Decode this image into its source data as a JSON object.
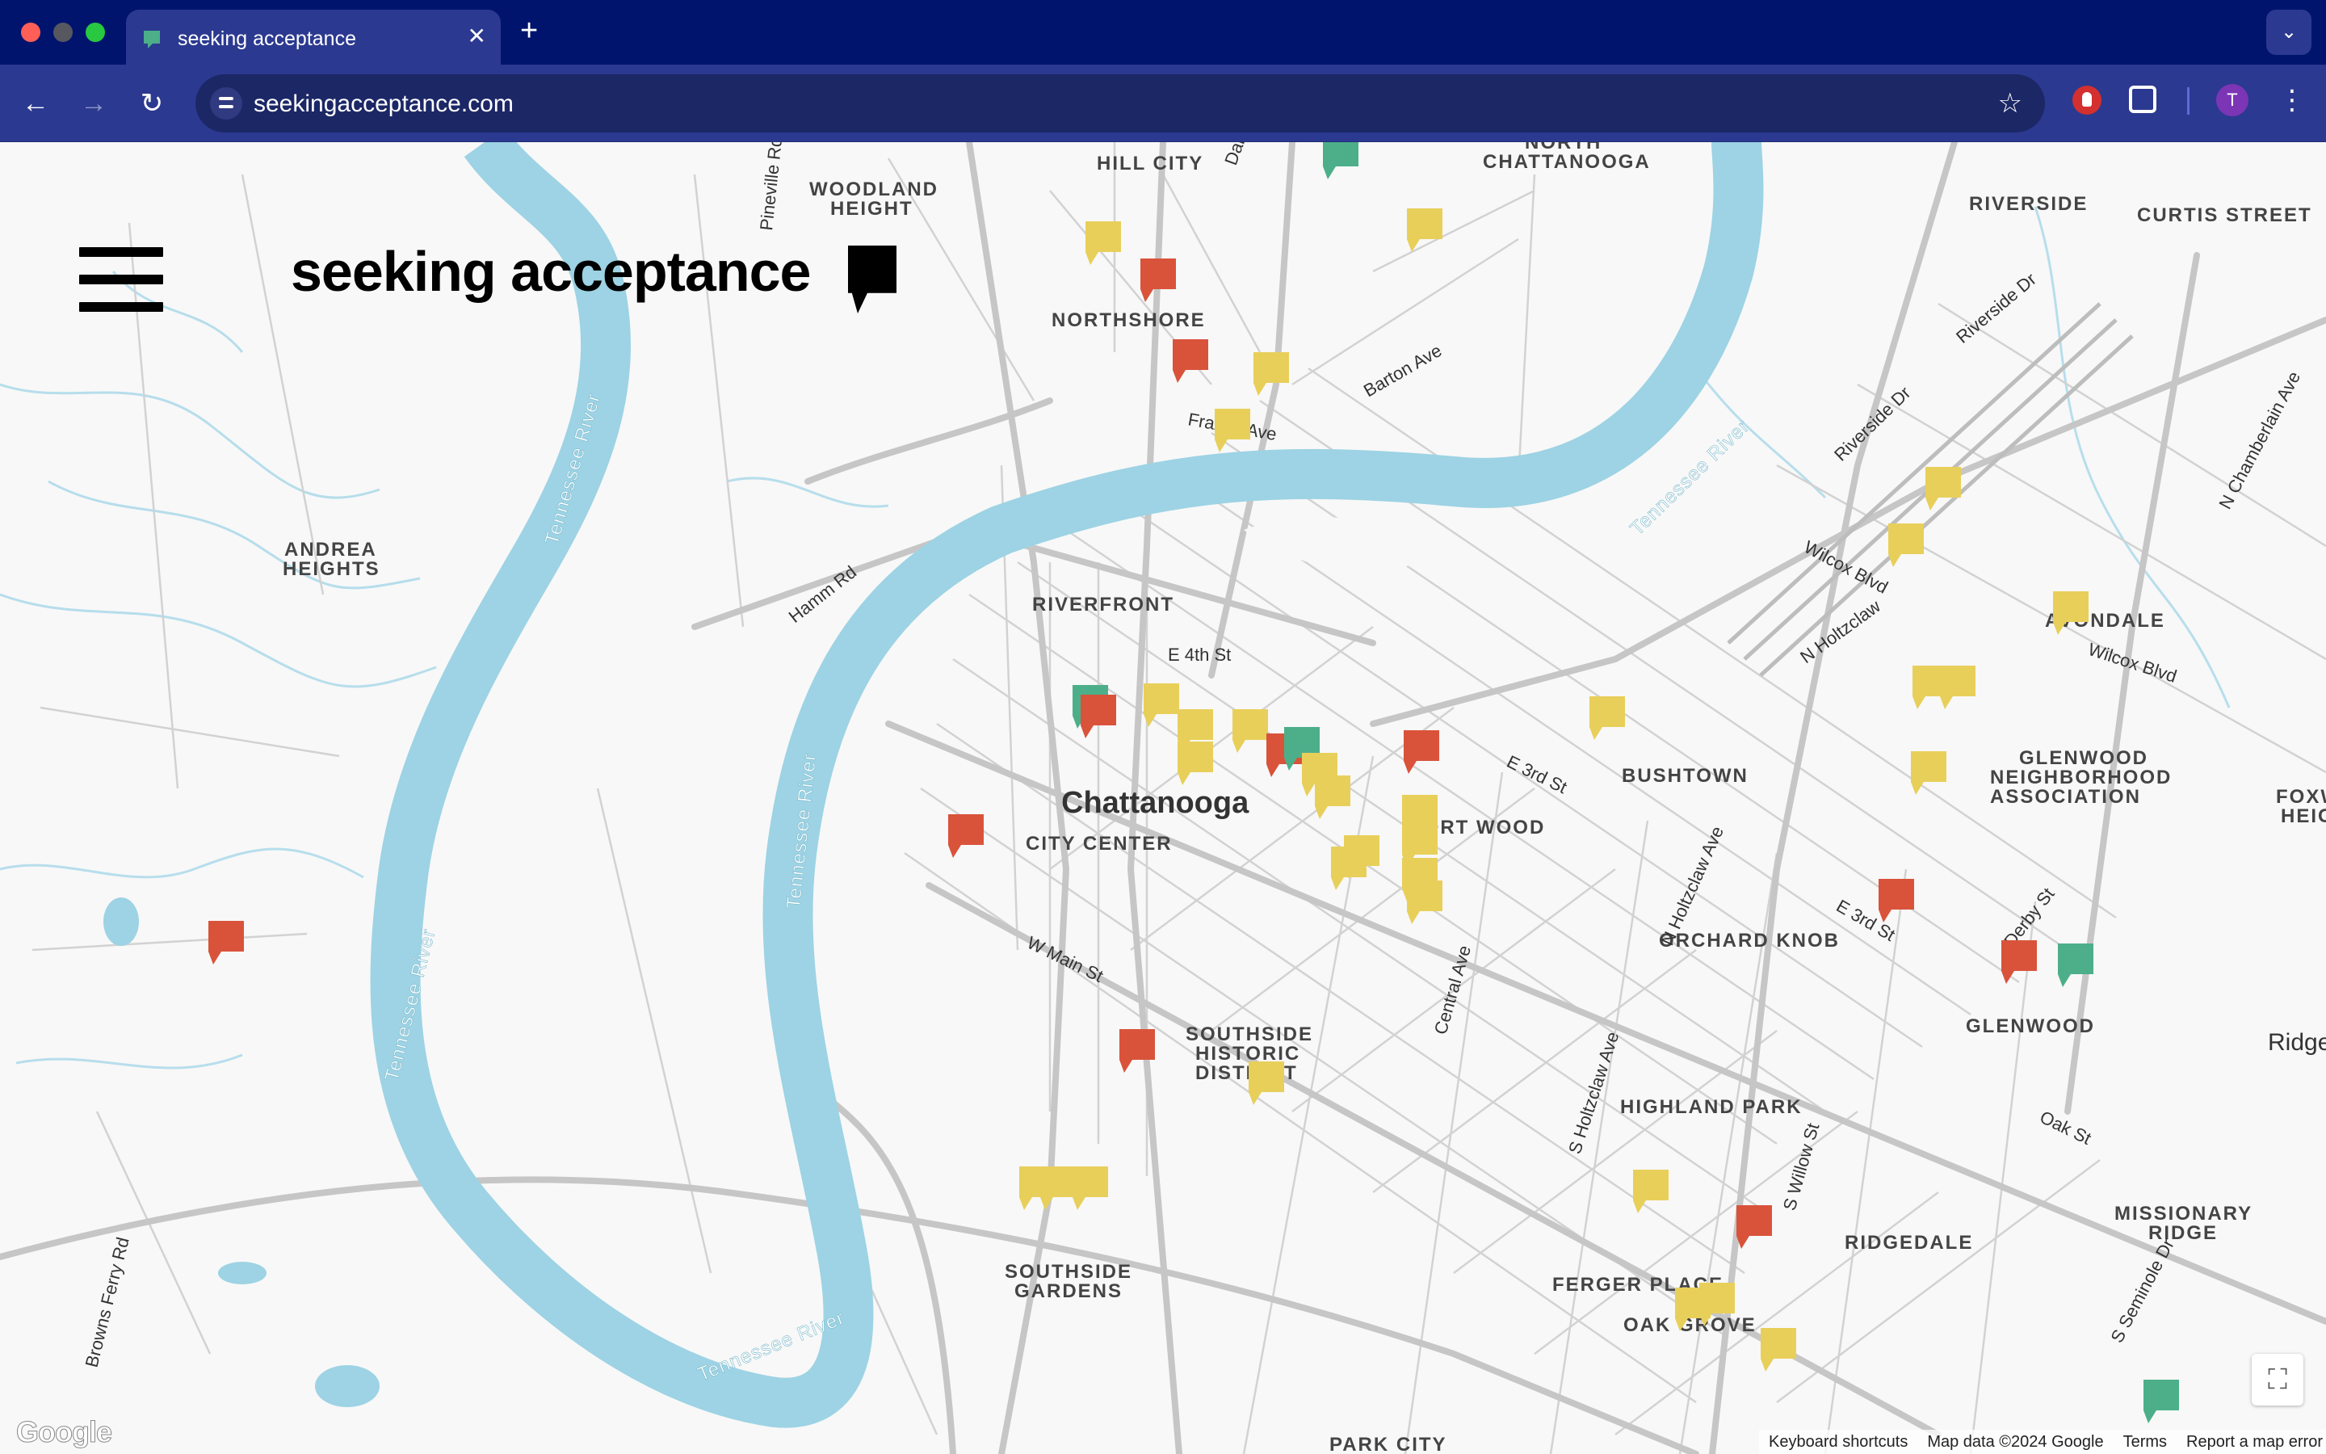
{
  "browser": {
    "tab_title": "seeking acceptance",
    "tab_close": "✕",
    "new_tab": "+",
    "url": "seekingacceptance.com",
    "back_icon": "←",
    "forward_icon": "→",
    "reload_icon": "↻",
    "star_icon": "☆",
    "profile_initial": "T",
    "menu_icon": "⋮",
    "tab_list_icon": "⌄"
  },
  "site": {
    "title": "seeking acceptance"
  },
  "map": {
    "fullscreen_icon": "⛶",
    "google_logo": "Google",
    "attribution": {
      "keyboard": "Keyboard shortcuts",
      "data": "Map data ©2024 Google",
      "terms": "Terms",
      "report": "Report a map error"
    },
    "marker_colors": {
      "yellow": "#e8cf5a",
      "red": "#d9533b",
      "green": "#4caf8a"
    },
    "water_color": "#9dd3e4",
    "labels": [
      {
        "text": "HILL CITY",
        "kind": "area"
      },
      {
        "text": "WOODLAND",
        "kind": "area"
      },
      {
        "text": "HEIGHT",
        "kind": "area"
      },
      {
        "text": "NORTH",
        "kind": "area"
      },
      {
        "text": "CHATTANOOGA",
        "kind": "area"
      },
      {
        "text": "RIVERSIDE",
        "kind": "area"
      },
      {
        "text": "CURTIS STREET",
        "kind": "area"
      },
      {
        "text": "NORTHSHORE",
        "kind": "area"
      },
      {
        "text": "ANDREA",
        "kind": "area"
      },
      {
        "text": "HEIGHTS",
        "kind": "area"
      },
      {
        "text": "RIVERFRONT",
        "kind": "area"
      },
      {
        "text": "Chattanooga",
        "kind": "city"
      },
      {
        "text": "CITY CENTER",
        "kind": "area"
      },
      {
        "text": "FORT WOOD",
        "kind": "area"
      },
      {
        "text": "BUSHTOWN",
        "kind": "area"
      },
      {
        "text": "AVONDALE",
        "kind": "area"
      },
      {
        "text": "GLENWOOD",
        "kind": "area"
      },
      {
        "text": "NEIGHBORHOOD",
        "kind": "area"
      },
      {
        "text": "ASSOCIATION",
        "kind": "area"
      },
      {
        "text": "ORCHARD KNOB",
        "kind": "area"
      },
      {
        "text": "GLENWOOD",
        "kind": "area"
      },
      {
        "text": "SOUTHSIDE",
        "kind": "area"
      },
      {
        "text": "HISTORIC",
        "kind": "area"
      },
      {
        "text": "DISTRICT",
        "kind": "area"
      },
      {
        "text": "HIGHLAND PARK",
        "kind": "area"
      },
      {
        "text": "RIDGEDALE",
        "kind": "area"
      },
      {
        "text": "MISSIONARY",
        "kind": "area"
      },
      {
        "text": "RIDGE",
        "kind": "area"
      },
      {
        "text": "FERGER PLACE",
        "kind": "area"
      },
      {
        "text": "OAK GROVE",
        "kind": "area"
      },
      {
        "text": "SOUTHSIDE",
        "kind": "area"
      },
      {
        "text": "GARDENS",
        "kind": "area"
      },
      {
        "text": "PARK CITY",
        "kind": "area"
      },
      {
        "text": "FOXW",
        "kind": "area"
      },
      {
        "text": "HEIG",
        "kind": "area"
      },
      {
        "text": "Ridge",
        "kind": "city"
      },
      {
        "text": "Tennessee River",
        "kind": "water"
      },
      {
        "text": "Tennessee River",
        "kind": "water"
      },
      {
        "text": "Tennessee River",
        "kind": "water"
      },
      {
        "text": "Tennessee River",
        "kind": "water"
      },
      {
        "text": "Tennessee River",
        "kind": "water"
      },
      {
        "text": "Barton Ave",
        "kind": "road"
      },
      {
        "text": "Frazier Ave",
        "kind": "road"
      },
      {
        "text": "Hamm Rd",
        "kind": "road"
      },
      {
        "text": "E 4th St",
        "kind": "road"
      },
      {
        "text": "E 3rd St",
        "kind": "road"
      },
      {
        "text": "E 3rd St",
        "kind": "road"
      },
      {
        "text": "W Main St",
        "kind": "road"
      },
      {
        "text": "Central Ave",
        "kind": "road"
      },
      {
        "text": "N Holtzclaw Ave",
        "kind": "road"
      },
      {
        "text": "S Holtzclaw Ave",
        "kind": "road"
      },
      {
        "text": "S Willow St",
        "kind": "road"
      },
      {
        "text": "Wilcox Blvd",
        "kind": "road"
      },
      {
        "text": "Wilcox Blvd",
        "kind": "road"
      },
      {
        "text": "N Holtzclaw",
        "kind": "road"
      },
      {
        "text": "Riverside Dr",
        "kind": "road"
      },
      {
        "text": "Riverside Dr",
        "kind": "road"
      },
      {
        "text": "N Chamberlain Ave",
        "kind": "road"
      },
      {
        "text": "Derby St",
        "kind": "road"
      },
      {
        "text": "Oak St",
        "kind": "road"
      },
      {
        "text": "S Seminole Dr",
        "kind": "road"
      },
      {
        "text": "Browns Ferry Rd",
        "kind": "road"
      },
      {
        "text": "Pineville Rd",
        "kind": "road"
      },
      {
        "text": "Dall",
        "kind": "road"
      }
    ],
    "markers": [
      {
        "color": "green"
      },
      {
        "color": "yellow"
      },
      {
        "color": "red"
      },
      {
        "color": "yellow"
      },
      {
        "color": "red"
      },
      {
        "color": "yellow"
      },
      {
        "color": "yellow"
      },
      {
        "color": "yellow"
      },
      {
        "color": "yellow"
      },
      {
        "color": "yellow"
      },
      {
        "color": "yellow"
      },
      {
        "color": "green"
      },
      {
        "color": "red"
      },
      {
        "color": "yellow"
      },
      {
        "color": "yellow"
      },
      {
        "color": "yellow"
      },
      {
        "color": "yellow"
      },
      {
        "color": "red"
      },
      {
        "color": "green"
      },
      {
        "color": "yellow"
      },
      {
        "color": "yellow"
      },
      {
        "color": "red"
      },
      {
        "color": "yellow"
      },
      {
        "color": "red"
      },
      {
        "color": "yellow"
      },
      {
        "color": "yellow"
      },
      {
        "color": "yellow"
      },
      {
        "color": "yellow"
      },
      {
        "color": "yellow"
      },
      {
        "color": "yellow"
      },
      {
        "color": "yellow"
      },
      {
        "color": "yellow"
      },
      {
        "color": "red"
      },
      {
        "color": "red"
      },
      {
        "color": "green"
      },
      {
        "color": "red"
      },
      {
        "color": "red"
      },
      {
        "color": "yellow"
      },
      {
        "color": "yellow"
      },
      {
        "color": "yellow"
      },
      {
        "color": "yellow"
      },
      {
        "color": "yellow"
      },
      {
        "color": "red"
      },
      {
        "color": "yellow"
      },
      {
        "color": "yellow"
      },
      {
        "color": "yellow"
      },
      {
        "color": "green"
      }
    ]
  }
}
